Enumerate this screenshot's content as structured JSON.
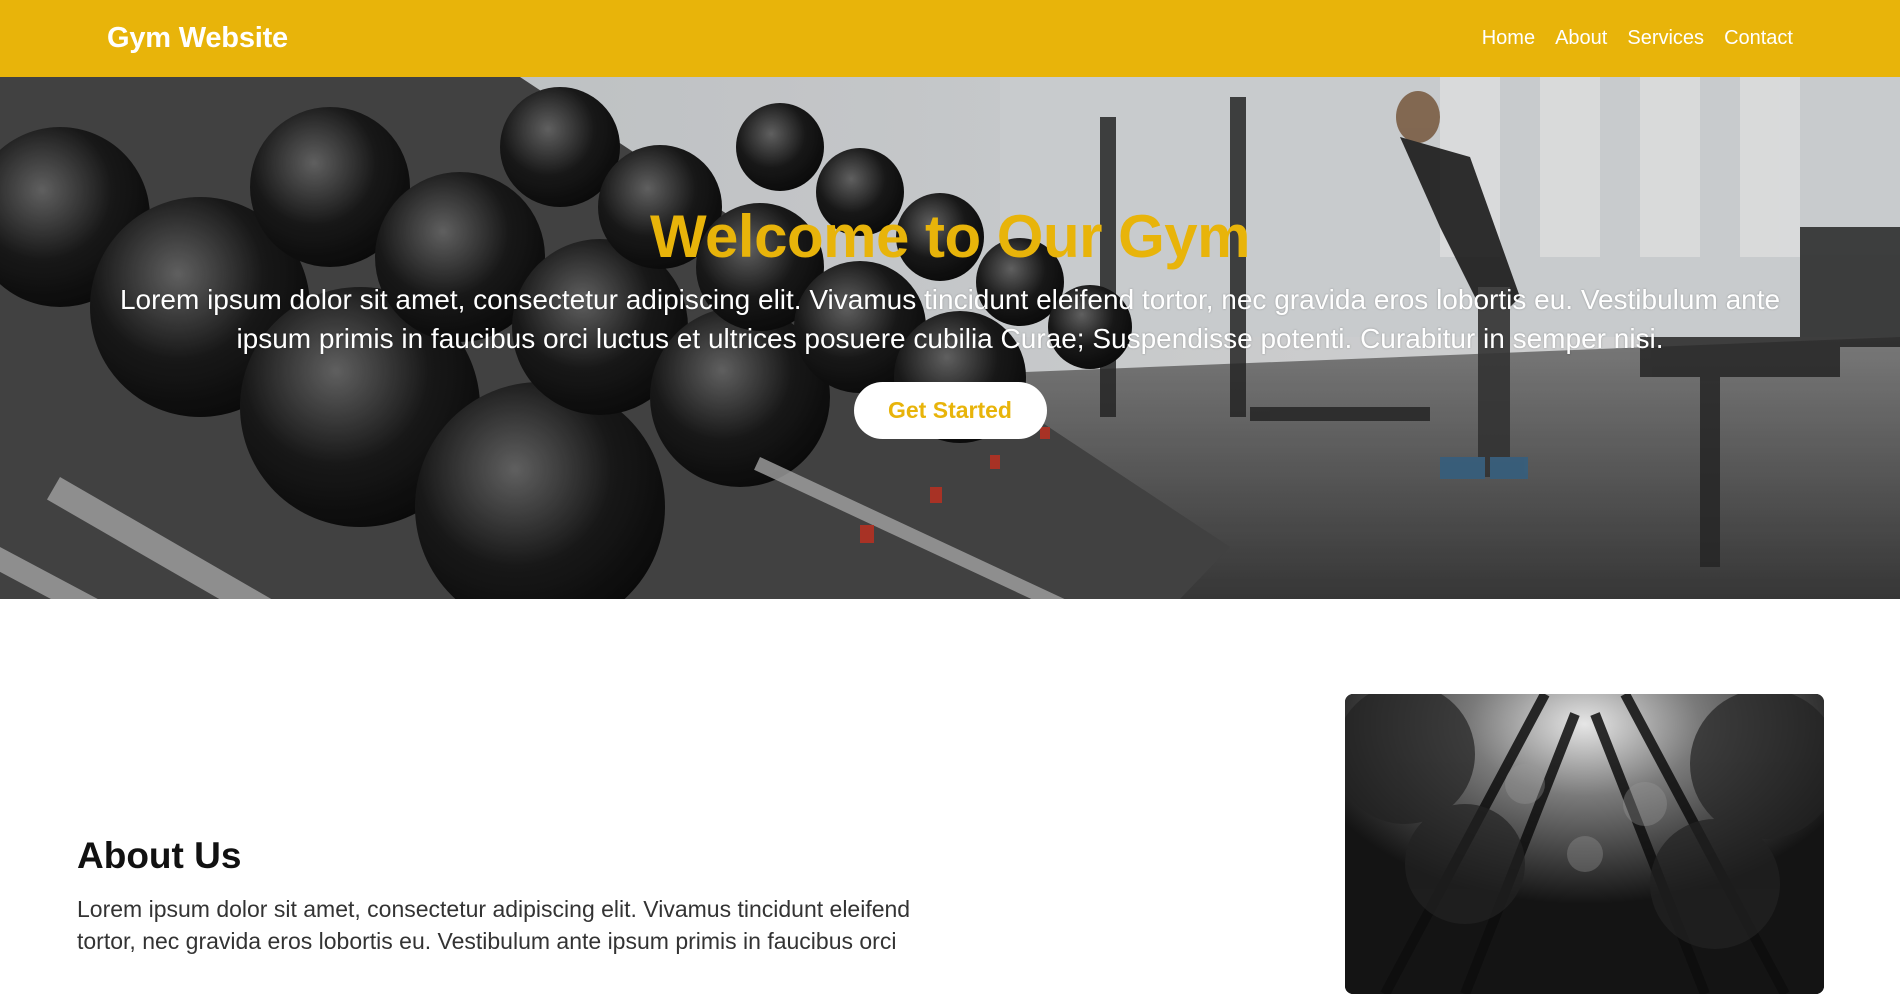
{
  "header": {
    "brand": "Gym Website",
    "nav": [
      "Home",
      "About",
      "Services",
      "Contact"
    ]
  },
  "hero": {
    "title": "Welcome to Our Gym",
    "text": "Lorem ipsum dolor sit amet, consectetur adipiscing elit. Vivamus tincidunt eleifend tortor, nec gravida eros lobortis eu. Vestibulum ante ipsum primis in faucibus orci luctus et ultrices posuere cubilia Curae; Suspendisse potenti. Curabitur in semper nisi.",
    "cta_label": "Get Started"
  },
  "about": {
    "title": "About Us",
    "body": "Lorem ipsum dolor sit amet, consectetur adipiscing elit. Vivamus tincidunt eleifend tortor, nec gravida eros lobortis eu. Vestibulum ante ipsum primis in faucibus orci"
  },
  "colors": {
    "accent": "#e8b40a",
    "white": "#ffffff",
    "text_dark": "#111111"
  }
}
